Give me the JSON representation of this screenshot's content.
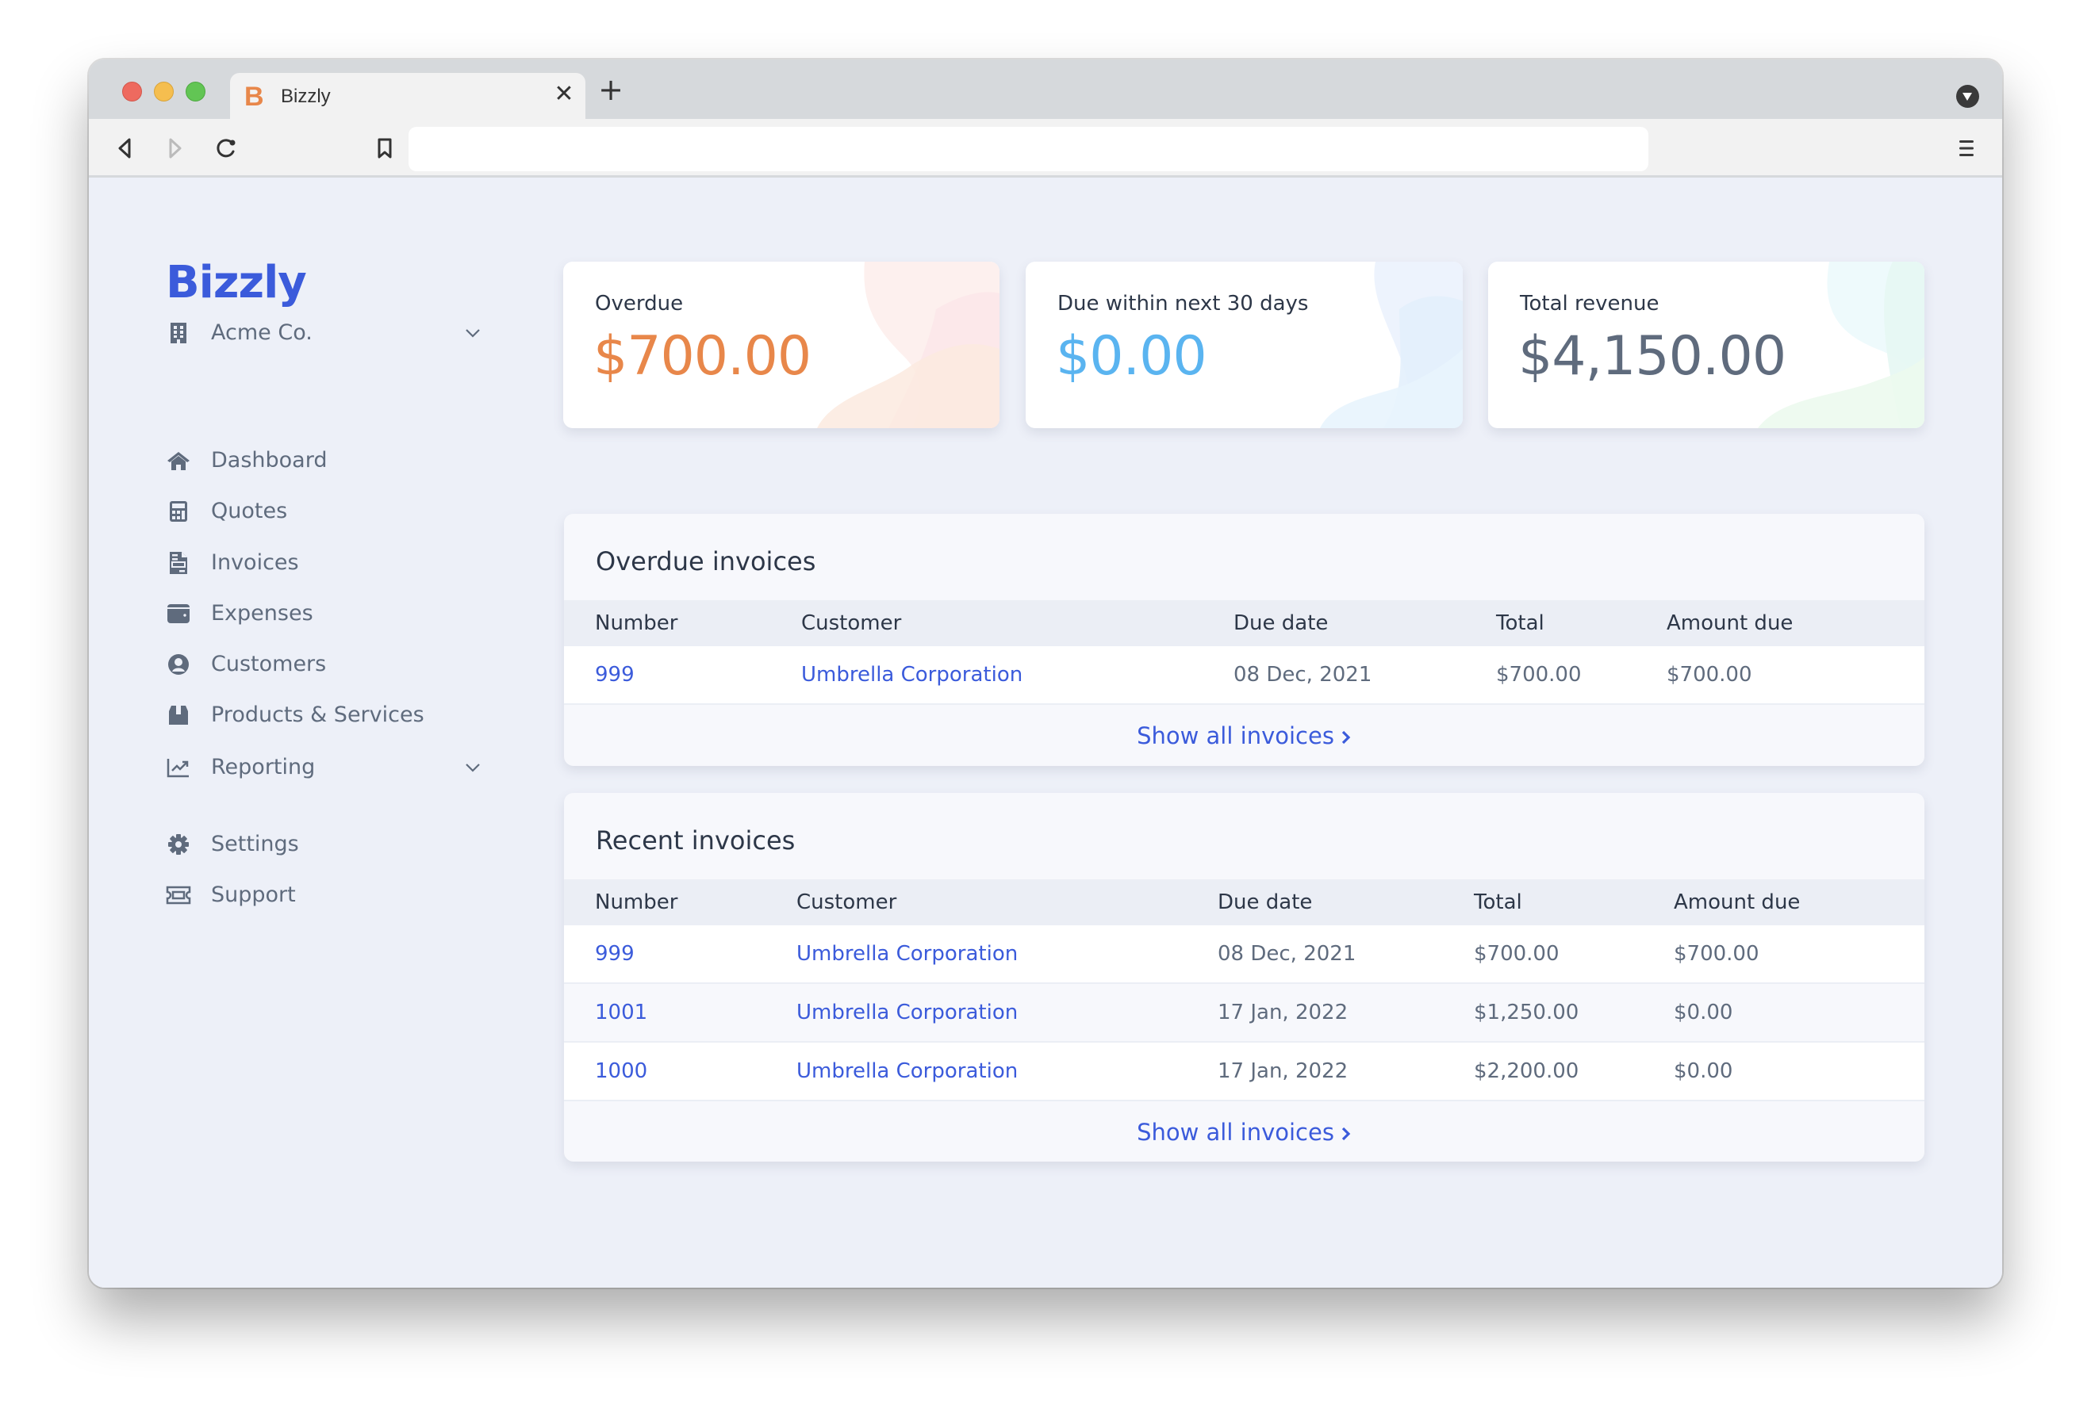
{
  "browser": {
    "tab_title": "Bizzly",
    "tab_favicon_letter": "B",
    "tab_close_glyph": "✕",
    "new_tab_glyph": "+",
    "address_value": "",
    "colors": {
      "favicon": "#e8874a"
    }
  },
  "app": {
    "logo": "Bizzly",
    "brand_color": "#3b5bdb",
    "company": {
      "name": "Acme Co.",
      "icon": "building-icon"
    }
  },
  "sidebar": {
    "items": [
      {
        "label": "Dashboard",
        "icon": "home-icon"
      },
      {
        "label": "Quotes",
        "icon": "calculator-icon"
      },
      {
        "label": "Invoices",
        "icon": "file-invoice-icon"
      },
      {
        "label": "Expenses",
        "icon": "wallet-icon"
      },
      {
        "label": "Customers",
        "icon": "user-circle-icon"
      },
      {
        "label": "Products & Services",
        "icon": "box-icon"
      },
      {
        "label": "Reporting",
        "icon": "chart-line-icon",
        "expandable": true
      }
    ],
    "secondary_items": [
      {
        "label": "Settings",
        "icon": "gear-icon"
      },
      {
        "label": "Support",
        "icon": "ticket-icon"
      }
    ]
  },
  "stats": [
    {
      "label": "Overdue",
      "value": "$700.00",
      "color": "#e8874a"
    },
    {
      "label": "Due within next 30 days",
      "value": "$0.00",
      "color": "#5ab4f0"
    },
    {
      "label": "Total revenue",
      "value": "$4,150.00",
      "color": "#5f6b7d"
    }
  ],
  "overdue_invoices": {
    "title": "Overdue invoices",
    "columns": [
      "Number",
      "Customer",
      "Due date",
      "Total",
      "Amount due"
    ],
    "rows": [
      {
        "number": "999",
        "customer": "Umbrella Corporation",
        "due_date": "08 Dec, 2021",
        "total": "$700.00",
        "amount_due": "$700.00"
      }
    ],
    "show_all": "Show all invoices"
  },
  "recent_invoices": {
    "title": "Recent invoices",
    "columns": [
      "Number",
      "Customer",
      "Due date",
      "Total",
      "Amount due"
    ],
    "rows": [
      {
        "number": "999",
        "customer": "Umbrella Corporation",
        "due_date": "08 Dec, 2021",
        "total": "$700.00",
        "amount_due": "$700.00"
      },
      {
        "number": "1001",
        "customer": "Umbrella Corporation",
        "due_date": "17 Jan, 2022",
        "total": "$1,250.00",
        "amount_due": "$0.00"
      },
      {
        "number": "1000",
        "customer": "Umbrella Corporation",
        "due_date": "17 Jan, 2022",
        "total": "$2,200.00",
        "amount_due": "$0.00"
      }
    ],
    "show_all": "Show all invoices"
  }
}
